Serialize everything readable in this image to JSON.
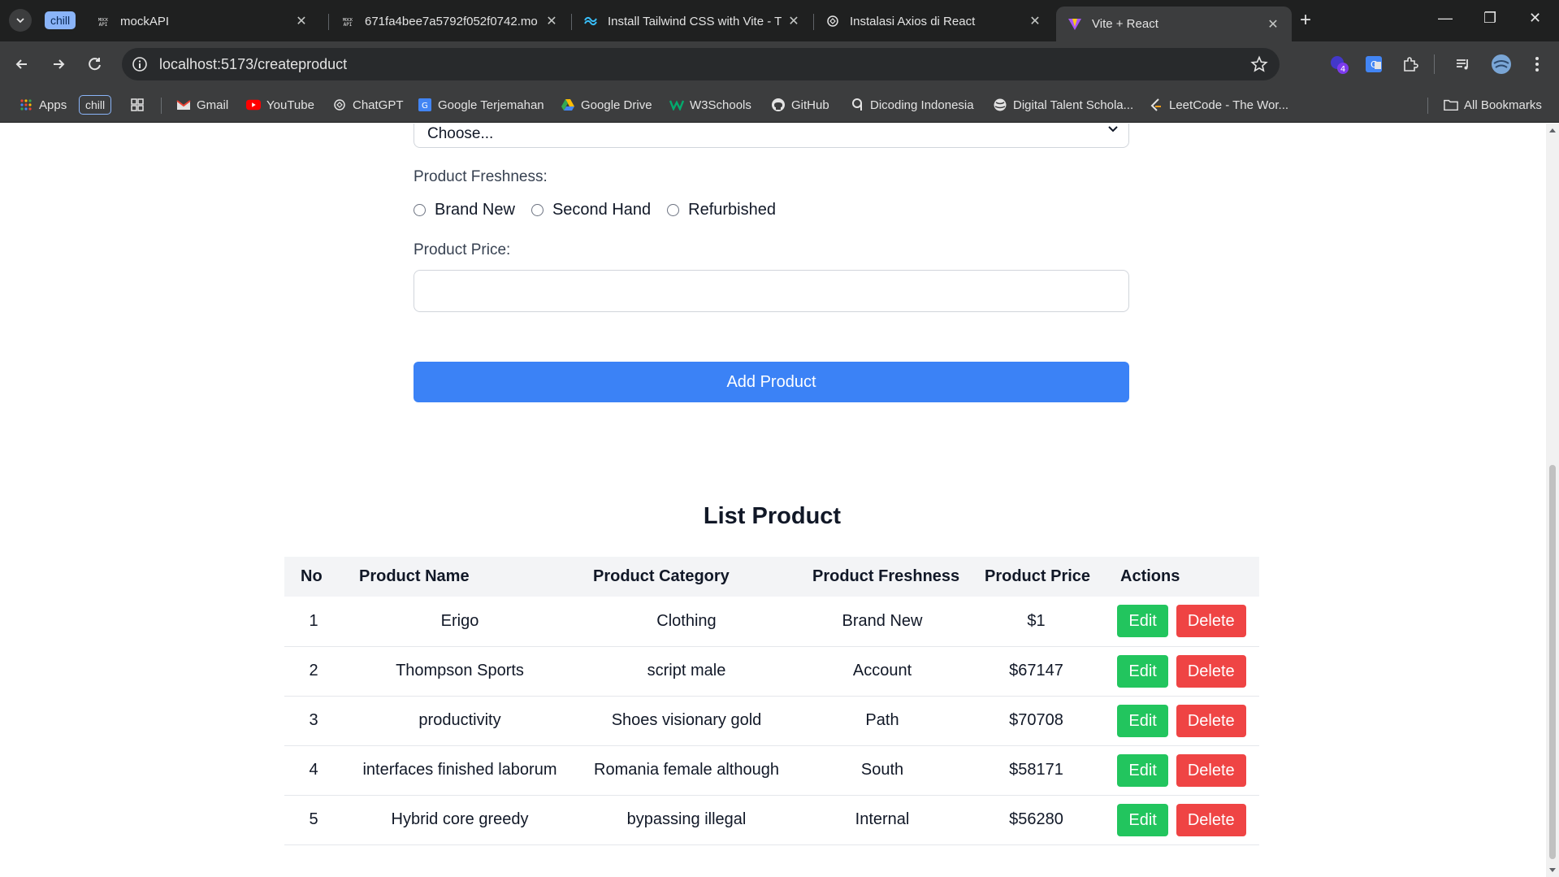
{
  "browser": {
    "tab_group_label": "chill",
    "tabs": [
      {
        "title": "mockAPI",
        "favicon": "mockapi-icon",
        "active": false
      },
      {
        "title": "671fa4bee7a5792f052f0742.mo",
        "favicon": "mockapi-icon",
        "active": false
      },
      {
        "title": "Install Tailwind CSS with Vite - T",
        "favicon": "tailwind-icon",
        "active": false
      },
      {
        "title": "Instalasi Axios di React",
        "favicon": "chatgpt-icon",
        "active": false
      },
      {
        "title": "Vite + React",
        "favicon": "vite-icon",
        "active": true
      }
    ],
    "url": "localhost:5173/createproduct",
    "extension_badge": "4",
    "bookmarks": [
      {
        "label": "Apps",
        "icon": "apps-grid-icon"
      },
      {
        "label": "chill",
        "icon": "chip"
      },
      {
        "label": "",
        "icon": "tab-groups-icon"
      },
      {
        "label": "Gmail",
        "icon": "gmail-icon"
      },
      {
        "label": "YouTube",
        "icon": "youtube-icon"
      },
      {
        "label": "ChatGPT",
        "icon": "chatgpt-icon"
      },
      {
        "label": "Google Terjemahan",
        "icon": "translate-icon"
      },
      {
        "label": "Google Drive",
        "icon": "drive-icon"
      },
      {
        "label": "W3Schools",
        "icon": "w3schools-icon"
      },
      {
        "label": "GitHub",
        "icon": "github-icon"
      },
      {
        "label": "Dicoding Indonesia",
        "icon": "dicoding-icon"
      },
      {
        "label": "Digital Talent Schola...",
        "icon": "globe-icon"
      },
      {
        "label": "LeetCode - The Wor...",
        "icon": "leetcode-icon"
      }
    ],
    "all_bookmarks": "All Bookmarks"
  },
  "form": {
    "category_select_value": "Choose...",
    "freshness_label": "Product Freshness:",
    "freshness_options": [
      "Brand New",
      "Second Hand",
      "Refurbished"
    ],
    "price_label": "Product Price:",
    "price_value": "",
    "submit_label": "Add Product"
  },
  "list": {
    "title": "List Product",
    "columns": [
      "No",
      "Product Name",
      "Product Category",
      "Product Freshness",
      "Product Price",
      "Actions"
    ],
    "rows": [
      {
        "no": "1",
        "name": "Erigo",
        "category": "Clothing",
        "freshness": "Brand New",
        "price": "$1"
      },
      {
        "no": "2",
        "name": "Thompson Sports",
        "category": "script male",
        "freshness": "Account",
        "price": "$67147"
      },
      {
        "no": "3",
        "name": "productivity",
        "category": "Shoes visionary gold",
        "freshness": "Path",
        "price": "$70708"
      },
      {
        "no": "4",
        "name": "interfaces finished laborum",
        "category": "Romania female although",
        "freshness": "South",
        "price": "$58171"
      },
      {
        "no": "5",
        "name": "Hybrid core greedy",
        "category": "bypassing illegal",
        "freshness": "Internal",
        "price": "$56280"
      }
    ],
    "edit_label": "Edit",
    "delete_label": "Delete"
  },
  "colors": {
    "primary": "#3b82f6",
    "edit": "#22c55e",
    "delete": "#ef4444",
    "chrome_dark": "#1f2020",
    "chrome_toolbar": "#3c3d3e"
  }
}
